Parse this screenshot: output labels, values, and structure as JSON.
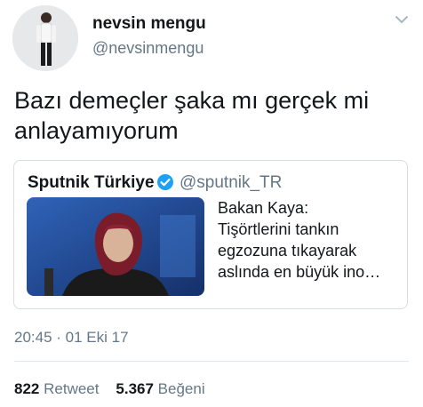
{
  "author": {
    "name": "nevsin mengu",
    "handle": "@nevsinmengu"
  },
  "tweet": {
    "text": "Bazı demeçler şaka mı gerçek mi anlayamıyorum"
  },
  "quoted": {
    "name": "Sputnik Türkiye",
    "handle": "@sputnik_TR",
    "lines": [
      "Bakan Kaya:",
      "Tişörtlerini tankın",
      "egzozuna tıkayarak",
      "aslında en büyük ino…"
    ]
  },
  "meta": {
    "timestamp": "20:45 · 01 Eki 17"
  },
  "stats": {
    "retweets": "822",
    "retweet_label": "Retweet",
    "likes": "5.367",
    "like_label": "Beğeni"
  },
  "icons": {
    "menu": "chevron-down-icon",
    "verified": "verified-badge-icon"
  },
  "colors": {
    "verified": "#1da1f2",
    "secondary_text": "#657786"
  }
}
